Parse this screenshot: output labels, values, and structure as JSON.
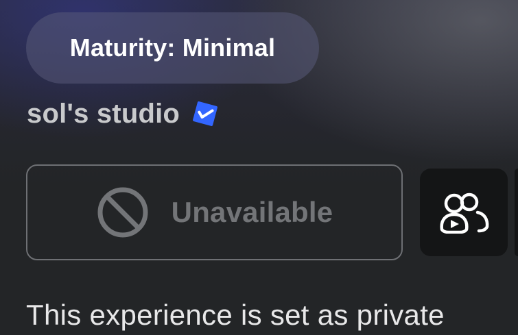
{
  "maturity": {
    "label": "Maturity: Minimal"
  },
  "creator": {
    "name": "sol's studio",
    "verified_icon": "verified-check-icon"
  },
  "play_button": {
    "label": "Unavailable",
    "icon": "ban-icon",
    "state": "disabled"
  },
  "party_button": {
    "icon": "party-play-icon"
  },
  "description": {
    "text": "This experience is set as private"
  },
  "colors": {
    "background": "#232527",
    "pill": "#4e5068",
    "verified_blue": "#3366ff",
    "disabled_text": "#737578",
    "party_button_bg": "#141516"
  }
}
